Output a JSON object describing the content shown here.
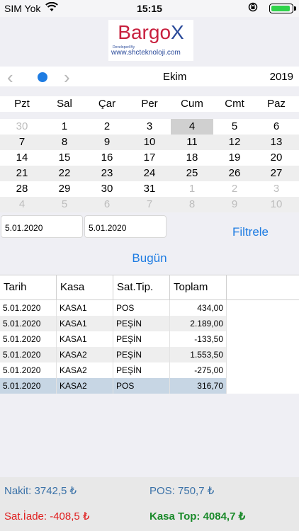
{
  "status": {
    "carrier": "SIM Yok",
    "time": "15:15"
  },
  "logo": {
    "brand_main": "Bargo",
    "brand_x": "X",
    "developed_by": "Developed By",
    "url": "www.shcteknoloji.com"
  },
  "calendar": {
    "prev": "‹",
    "next": "›",
    "month": "Ekim",
    "year": "2019",
    "weekdays": [
      "Pzt",
      "Sal",
      "Çar",
      "Per",
      "Cum",
      "Cmt",
      "Paz"
    ],
    "rows": [
      [
        "30",
        "1",
        "2",
        "3",
        "4",
        "5",
        "6"
      ],
      [
        "7",
        "8",
        "9",
        "10",
        "11",
        "12",
        "13"
      ],
      [
        "14",
        "15",
        "16",
        "17",
        "18",
        "19",
        "20"
      ],
      [
        "21",
        "22",
        "23",
        "24",
        "25",
        "26",
        "27"
      ],
      [
        "28",
        "29",
        "30",
        "31",
        "1",
        "2",
        "3"
      ],
      [
        "4",
        "5",
        "6",
        "7",
        "8",
        "9",
        "10"
      ]
    ]
  },
  "filters": {
    "start_date": "5.01.2020",
    "end_date": "5.01.2020",
    "filter_label": "Filtrele",
    "today_label": "Bugün"
  },
  "table": {
    "headers": [
      "Tarih",
      "Kasa",
      "Sat.Tip.",
      "Toplam"
    ],
    "rows": [
      [
        "5.01.2020",
        "KASA1",
        "POS",
        "434,00"
      ],
      [
        "5.01.2020",
        "KASA1",
        "PEŞİN",
        "2.189,00"
      ],
      [
        "5.01.2020",
        "KASA1",
        "PEŞİN",
        "-133,50"
      ],
      [
        "5.01.2020",
        "KASA2",
        "PEŞİN",
        "1.553,50"
      ],
      [
        "5.01.2020",
        "KASA2",
        "PEŞİN",
        "-275,00"
      ],
      [
        "5.01.2020",
        "KASA2",
        "POS",
        "316,70"
      ]
    ]
  },
  "summary": {
    "nakit": "Nakit: 3742,5 ₺",
    "pos": "POS: 750,7 ₺",
    "iade": "Sat.İade: -408,5 ₺",
    "kasa_top": "Kasa Top: 4084,7 ₺"
  }
}
